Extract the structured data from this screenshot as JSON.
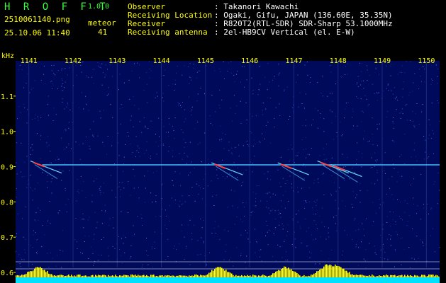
{
  "header": {
    "app_title": "H R O F F T",
    "app_version": "1.0.0",
    "filename": "2510061140.png",
    "timestamp": "25.10.06 11:40",
    "meteor_label": "meteor",
    "meteor_count": "41",
    "fields": [
      {
        "label": "Observer",
        "value": ": Takanori Kawachi"
      },
      {
        "label": "Receiving Location",
        "value": ": Ogaki, Gifu, JAPAN (136.60E, 35.35N)"
      },
      {
        "label": "Receiver",
        "value": ": R820T2(RTL-SDR) SDR-Sharp 53.1000MHz"
      },
      {
        "label": "Receiving antenna",
        "value": ": 2el-HB9CV Vertical (el. E-W)"
      }
    ]
  },
  "chart_data": {
    "type": "heatmap",
    "ylabel": "kHz",
    "x_ticks": [
      "1141",
      "1142",
      "1143",
      "1144",
      "1145",
      "1146",
      "1147",
      "1148",
      "1149",
      "1150"
    ],
    "y_ticks": [
      "1.1",
      "1.0",
      "0.9",
      "0.8",
      "0.7",
      "0.6"
    ],
    "carrier_khz": 0.905,
    "echoes": [
      {
        "minute": 1141.1,
        "freq_khz": 0.91
      },
      {
        "minute": 1145.2,
        "freq_khz": 0.905
      },
      {
        "minute": 1146.7,
        "freq_khz": 0.905
      },
      {
        "minute": 1147.6,
        "freq_khz": 0.91
      },
      {
        "minute": 1147.9,
        "freq_khz": 0.9
      }
    ],
    "colors": {
      "background": "#000a5a",
      "carrier": "#40c0ff",
      "echo": "#ff4040",
      "power": "#ffff00",
      "baseline": "#00e0ff"
    }
  }
}
